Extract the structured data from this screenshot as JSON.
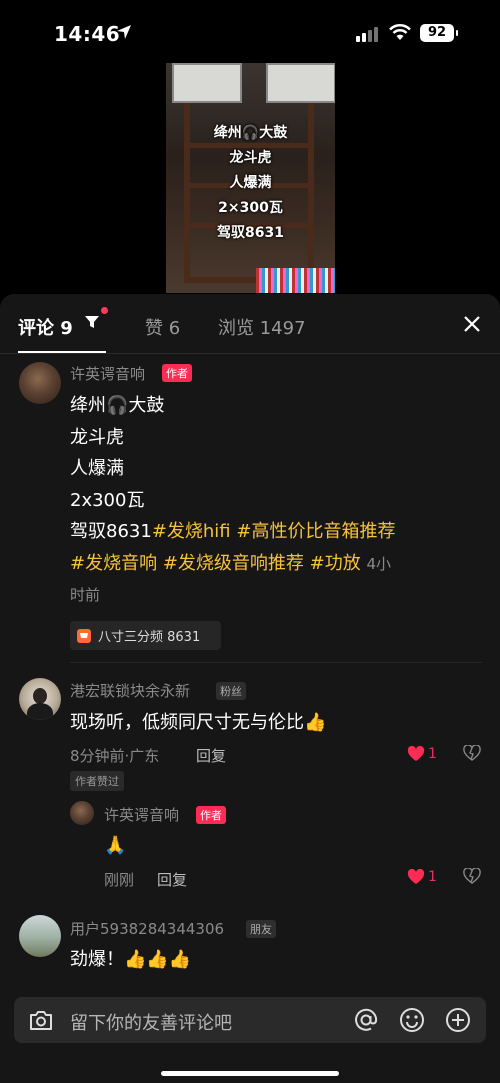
{
  "status_bar": {
    "time": "14:46",
    "battery": "92"
  },
  "video": {
    "overlay_lines": [
      "绛州🎧大鼓",
      "龙斗虎",
      "人爆满",
      "2×300瓦",
      "驾驭8631"
    ]
  },
  "tabs": {
    "comments": "评论 9",
    "likes": "赞 6",
    "views": "浏览 1497"
  },
  "comments": [
    {
      "user": "许英谔音响",
      "badge": "作者",
      "lines": [
        "绛州🎧大鼓",
        "龙斗虎",
        "人爆满",
        "2x300瓦"
      ],
      "line5_prefix": "驾驭8631",
      "tag1": "#发烧hifi",
      "tag2": "#高性价比音箱推荐",
      "tag3": "#发烧音响",
      "tag4": "#发烧级音响推荐",
      "tag5": "#功放",
      "time_a": "4小",
      "time_b": "时前",
      "product": "八寸三分频 8631"
    },
    {
      "user": "港宏联锁块余永新",
      "badge": "粉丝",
      "text": "现场听，低频同尺寸无与伦比👍",
      "time": "8分钟前·广东",
      "reply": "回复",
      "likes": "1",
      "author_liked": "作者赞过"
    },
    {
      "user": "许英谔音响",
      "badge": "作者",
      "text": "🙏",
      "time": "刚刚",
      "reply": "回复",
      "likes": "1"
    },
    {
      "user": "用户5938284344306",
      "badge": "朋友",
      "text": "劲爆！👍👍👍"
    }
  ],
  "input": {
    "placeholder": "留下你的友善评论吧"
  }
}
